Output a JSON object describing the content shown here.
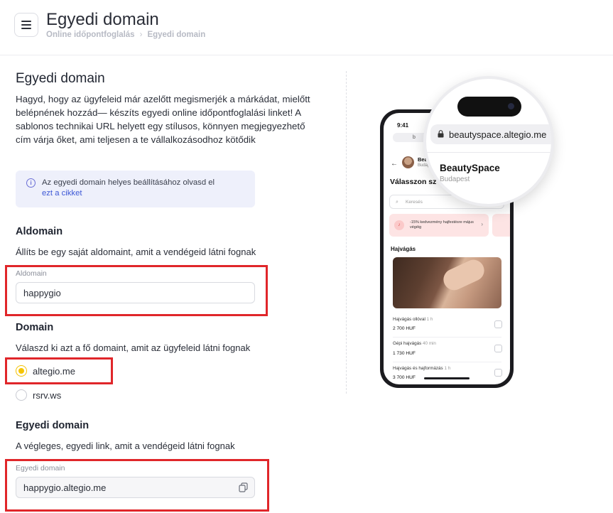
{
  "header": {
    "title": "Egyedi domain",
    "breadcrumb": [
      "Online időpontfoglalás",
      "Egyedi domain"
    ],
    "menu_icon": "hamburger-menu-icon"
  },
  "main": {
    "section_title": "Egyedi domain",
    "intro": "Hagyd, hogy az ügyfeleid már azelőtt megismerjék a márkádat, mielőtt belépnének hozzád— készíts egyedi online időpontfoglalási linket! A sablonos technikai URL helyett egy stílusos, könnyen megjegyezhető cím várja őket, ami teljesen a te vállalkozásodhoz kötődik",
    "info": {
      "text": "Az egyedi domain helyes beállításához olvasd el",
      "link": "ezt a cikket",
      "icon": "info-icon",
      "bg_color": "#eef0fb"
    },
    "subdomain": {
      "heading": "Aldomain",
      "description": "Állíts be egy saját aldomaint, amit a vendégeid látni fognak",
      "field_label": "Aldomain",
      "value": "happygio"
    },
    "domain": {
      "heading": "Domain",
      "description": "Válaszd ki azt a fő domaint, amit az ügyfeleid látni fognak",
      "options": [
        {
          "label": "altegio.me",
          "selected": true
        },
        {
          "label": "rsrv.ws",
          "selected": false
        }
      ],
      "accent_color": "#f5c400"
    },
    "custom_domain": {
      "heading": "Egyedi domain",
      "description": "A végleges, egyedi link, amit a vendégeid látni fognak",
      "field_label": "Egyedi domain",
      "value": "happygio.altegio.me",
      "copy_icon": "copy-icon"
    },
    "highlight_color": "#e0262a"
  },
  "preview": {
    "status_time": "9:41",
    "url_mini": "b",
    "business_name_mini": "Bea",
    "city_mini": "Budap",
    "heading": "Válasszon sz",
    "search_placeholder": "Keresés",
    "promo": "-15% kedvezmény hajfestésre május végéig",
    "section": "Hajvágás",
    "services": [
      {
        "name": "Hajvágás ollóval",
        "duration": "1 h",
        "price": "2 700 HUF"
      },
      {
        "name": "Gépi hajvágás",
        "duration": "40 min",
        "price": "1 730 HUF"
      },
      {
        "name": "Hajvágás és hajformázás",
        "duration": "1 h",
        "price": "3 700 HUF"
      }
    ],
    "magnifier": {
      "url": "beautyspace.altegio.me",
      "business_name": "BeautySpace",
      "city": "Budapest"
    }
  }
}
